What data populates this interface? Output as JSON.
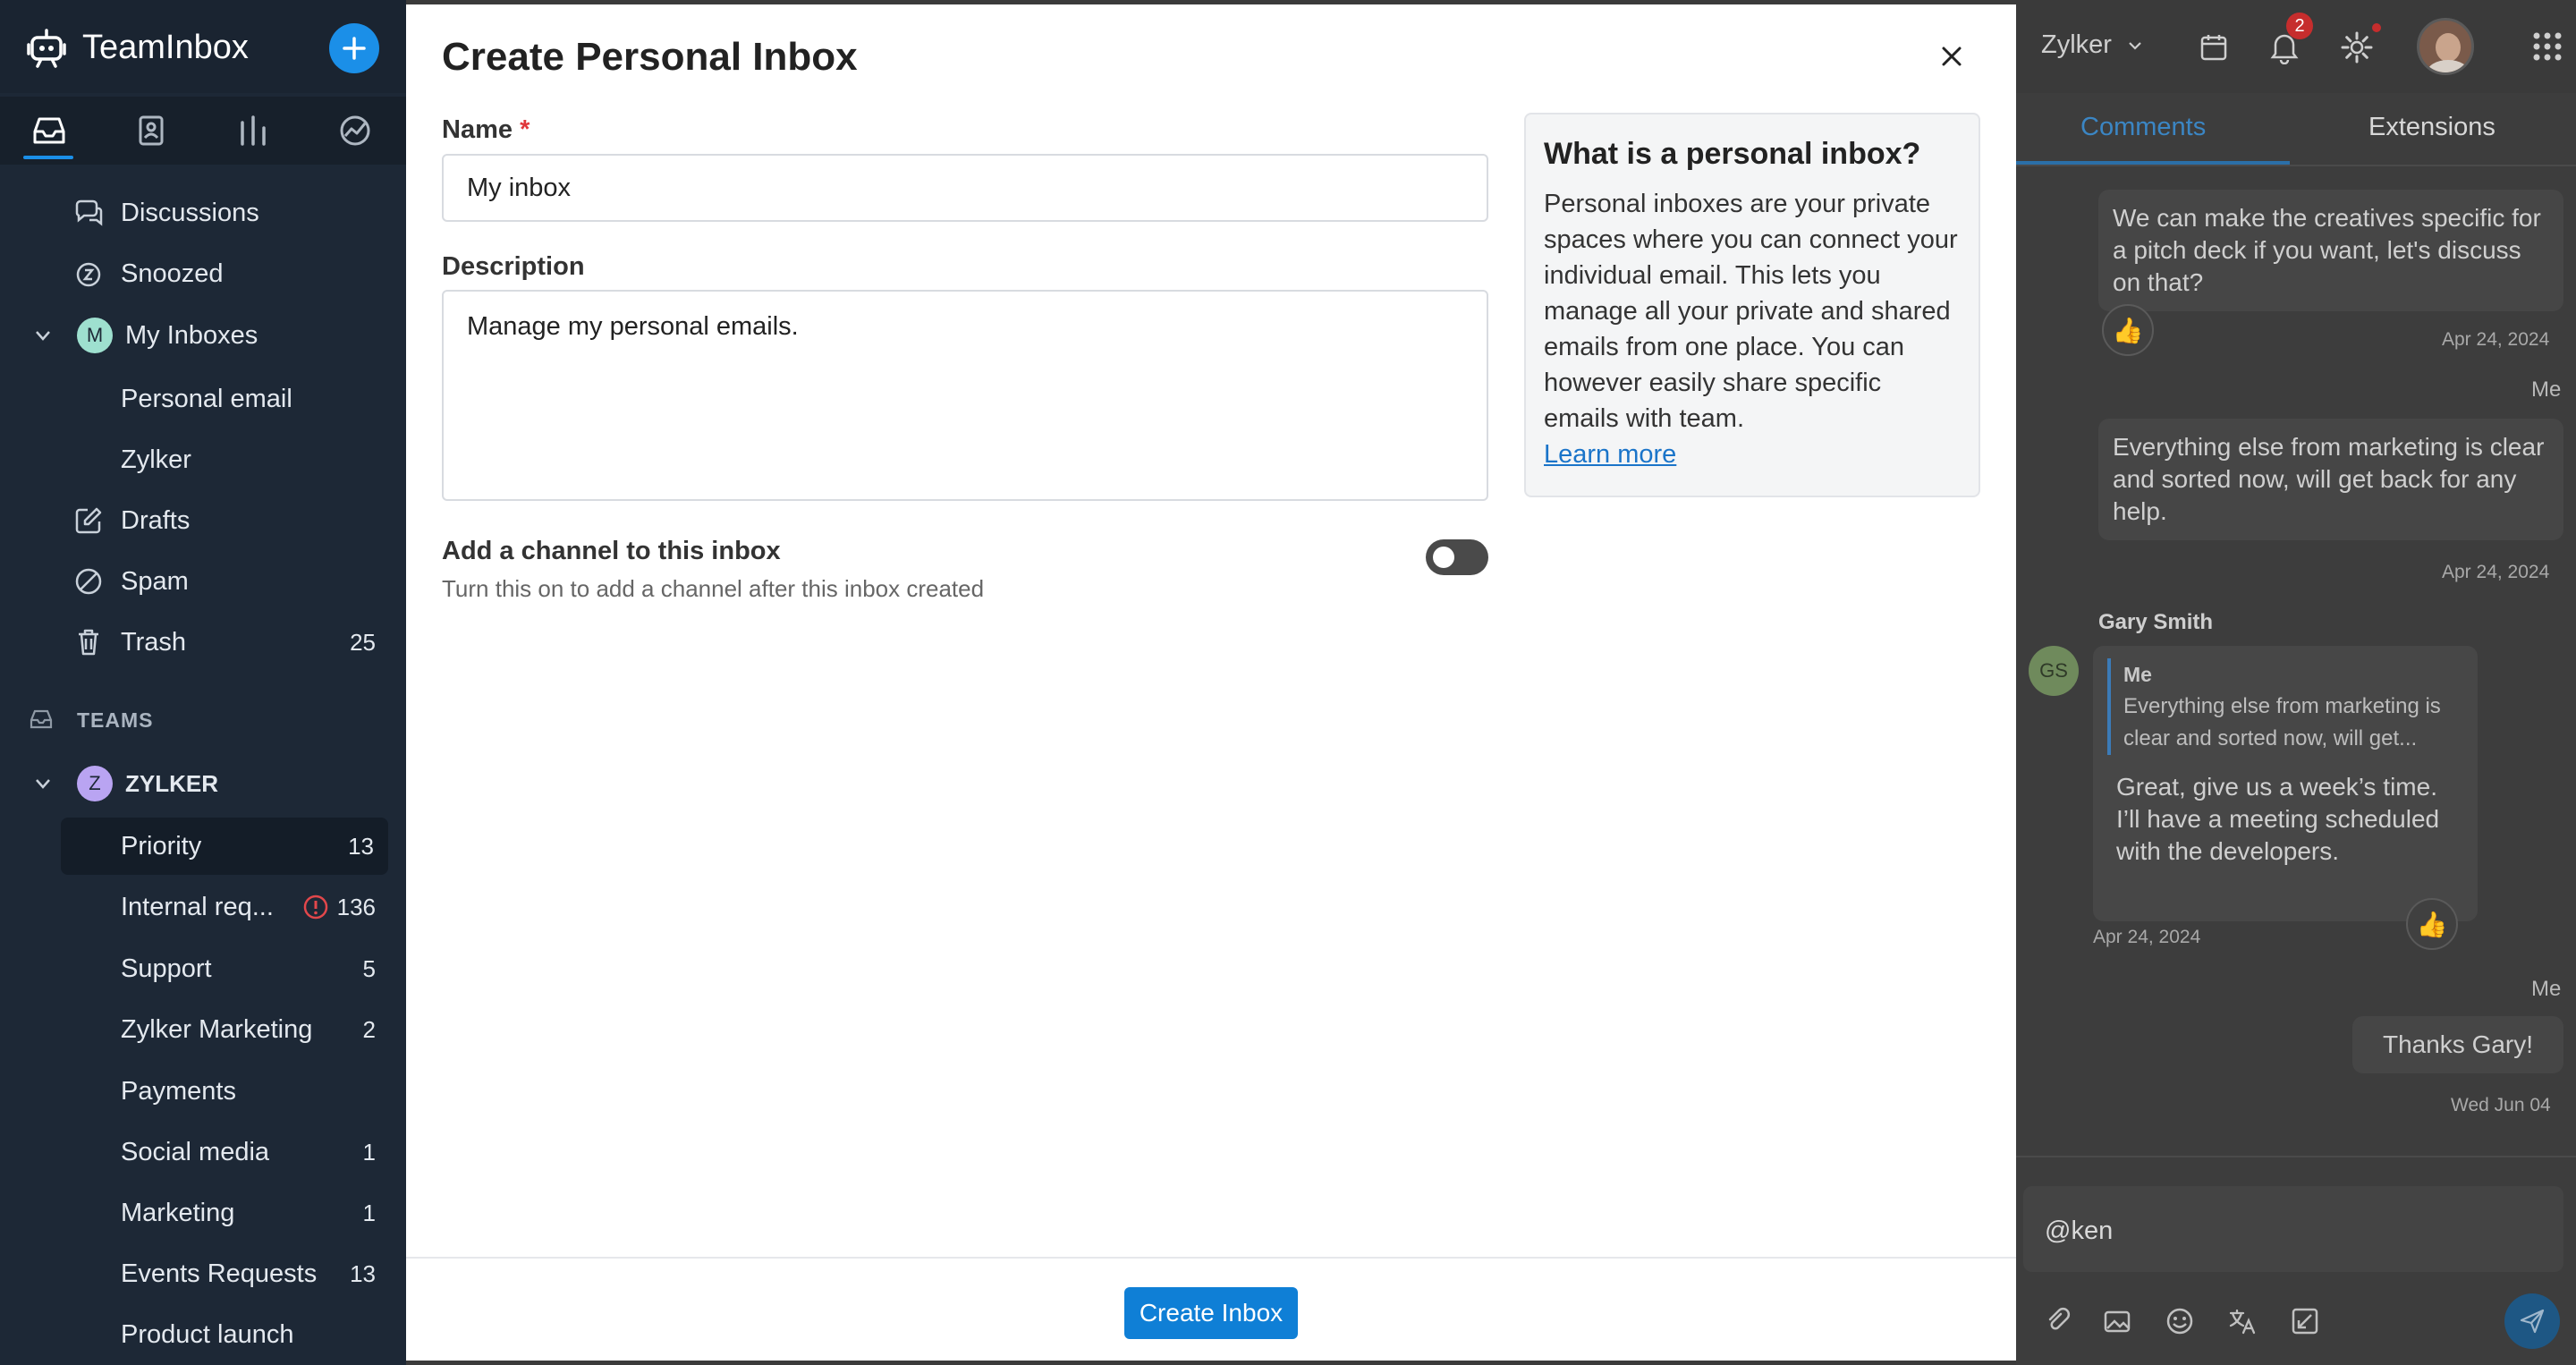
{
  "app": {
    "title": "TeamInbox"
  },
  "sidebar": {
    "items": [
      {
        "label": "Discussions",
        "icon": "discussions-icon"
      },
      {
        "label": "Snoozed",
        "icon": "snooze-icon"
      },
      {
        "label": "My Inboxes",
        "avatar": "M"
      },
      {
        "label": "Personal email"
      },
      {
        "label": "Zylker"
      },
      {
        "label": "Drafts",
        "icon": "drafts-icon"
      },
      {
        "label": "Spam",
        "icon": "spam-icon"
      },
      {
        "label": "Trash",
        "icon": "trash-icon",
        "count": "25"
      }
    ],
    "teams_header": "TEAMS",
    "team": {
      "name": "ZYLKER",
      "avatar": "Z"
    },
    "team_items": [
      {
        "label": "Priority",
        "count": "13",
        "selected": true
      },
      {
        "label": "Internal req...",
        "count": "136",
        "alert": true
      },
      {
        "label": "Support",
        "count": "5"
      },
      {
        "label": "Zylker Marketing",
        "count": "2"
      },
      {
        "label": "Payments",
        "count": ""
      },
      {
        "label": "Social media",
        "count": "1"
      },
      {
        "label": "Marketing",
        "count": "1"
      },
      {
        "label": "Events Requests",
        "count": "13"
      },
      {
        "label": "Product launch",
        "count": ""
      }
    ]
  },
  "modal": {
    "title": "Create Personal Inbox",
    "name_label": "Name",
    "required_mark": "*",
    "name_value": "My inbox",
    "description_label": "Description",
    "description_value": "Manage my personal emails.",
    "channel_title": "Add a channel to this inbox",
    "channel_hint": "Turn this on to add a channel after this inbox created",
    "channel_toggle_on": false,
    "info_title": "What is a personal inbox?",
    "info_body": "Personal inboxes are your private spaces where you can connect your individual email. This lets you manage all your private and shared emails from one place. You can however easily share specific emails with team.",
    "info_link": "Learn more",
    "create_button": "Create Inbox"
  },
  "right_panel": {
    "org": "Zylker",
    "notification_count": "2",
    "tabs": [
      "Comments",
      "Extensions"
    ],
    "messages": [
      {
        "text": "We can make the creatives specific for a pitch deck if you want, let's discuss on that?",
        "date": "Apr 24, 2024"
      },
      {
        "author": "Me",
        "text": "Everything else from marketing is clear and sorted now, will get back for any help.",
        "date": "Apr 24, 2024"
      },
      {
        "author": "Gary Smith",
        "initials": "GS",
        "quote_author": "Me",
        "quote": "Everything else from marketing is clear and sorted now, will get...",
        "text": "Great, give us a week’s time. I’ll have a meeting scheduled with the developers.",
        "date": "Apr 24, 2024"
      },
      {
        "author": "Me",
        "text": "Thanks Gary!",
        "date": "Wed Jun 04"
      }
    ],
    "composer_value": "@ken"
  },
  "colors": {
    "accent": "#1b8fe8",
    "sidebar_bg": "#1d2836",
    "button": "#0f7fd6",
    "required": "#e0363a"
  }
}
